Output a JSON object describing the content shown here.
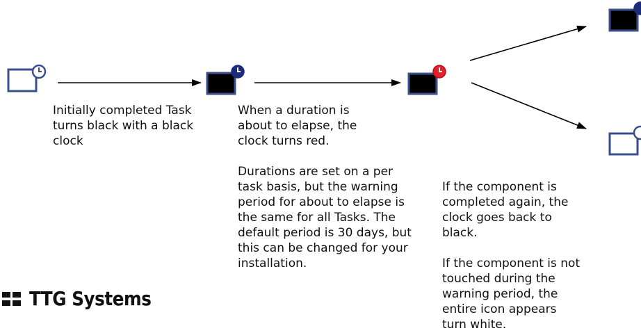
{
  "captions": {
    "initial": "Initially completed Task turns black with a black clock",
    "elapse": "When a duration is about to elapse, the clock turns red.",
    "durations": "Durations are set on a per task basis, but the warning period for about to elapse is the same for all Tasks. The default period is 30 days, but this can be changed for your installation.",
    "completed_again": "If the component is completed again, the clock goes back to black.",
    "not_touched": "If the component is not touched during the warning period, the entire icon appears turn white."
  },
  "brand": {
    "name": "TTG Systems"
  },
  "colors": {
    "icon_border": "#3a4e8c",
    "task_white": "#ffffff",
    "task_black": "#000000",
    "clock_navy": "#1c2c78",
    "clock_red": "#e0202a",
    "arrow": "#000000"
  },
  "icons": {
    "task_white": "task-white-clock-icon",
    "task_black": "task-black-clock-icon",
    "task_red": "task-red-clock-icon"
  }
}
